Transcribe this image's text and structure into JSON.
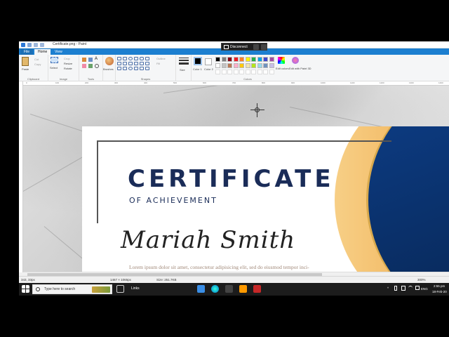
{
  "window": {
    "title": "Certificate.png - Paint"
  },
  "remote": {
    "label": "Disconnect"
  },
  "tabs": [
    {
      "label": "File"
    },
    {
      "label": "Home"
    },
    {
      "label": "View"
    }
  ],
  "ribbon": {
    "clipboard": {
      "paste": "Paste",
      "cut": "Cut",
      "copy": "Copy",
      "label": "Clipboard"
    },
    "image": {
      "select": "Select",
      "crop": "Crop",
      "resize": "Resize",
      "rotate": "Rotate",
      "label": "Image"
    },
    "tools": {
      "label": "Tools"
    },
    "brushes": {
      "label": "Brushes"
    },
    "shapes": {
      "outline": "Outline",
      "fill": "Fill",
      "label": "Shapes"
    },
    "size": {
      "label": "Size"
    },
    "colors": {
      "color1": "Color 1",
      "color2": "Color 2",
      "edit": "Edit colors",
      "paint3d": "Edit with Paint 3D",
      "label": "Colors",
      "swatches_top": [
        "#000000",
        "#7f7f7f",
        "#880015",
        "#ed1c24",
        "#ff7f27",
        "#fff200",
        "#22b14c",
        "#00a2e8",
        "#3f48cc",
        "#a349a4"
      ],
      "swatches_bottom": [
        "#ffffff",
        "#c3c3c3",
        "#b97a57",
        "#ffaec9",
        "#ffc90e",
        "#efe4b0",
        "#b5e61d",
        "#99d9ea",
        "#7092be",
        "#c8bfe7"
      ]
    }
  },
  "ruler": {
    "ticks": [
      "0",
      "100",
      "200",
      "300",
      "400",
      "500",
      "600",
      "700",
      "800",
      "900",
      "1000",
      "1100",
      "1200",
      "1300",
      "1400"
    ]
  },
  "certificate": {
    "title": "CERTIFICATE",
    "subtitle": "OF ACHIEVEMENT",
    "name": "Mariah Smith",
    "body": "Lorem ipsum dolor sit amet, consectetur adipisicing elit, sed do eiusmod tempor inci-"
  },
  "status": {
    "position": "343, 33px",
    "dimensions": "1467 × 1065px",
    "size": "Size: 251.7KB",
    "zoom": "300%"
  },
  "taskbar": {
    "search_placeholder": "Type here to search",
    "links": "Links",
    "lang": "ENG",
    "time": "2:55 pm",
    "date": "18-Feb-20"
  }
}
